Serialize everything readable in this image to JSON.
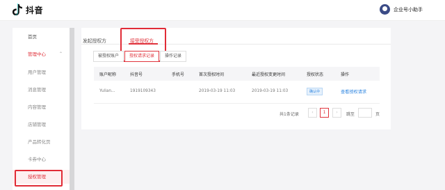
{
  "header": {
    "app_name": "抖音",
    "user_name": "企业号小助手"
  },
  "sidebar": {
    "items": [
      {
        "label": "首页"
      },
      {
        "label": "管理中心"
      },
      {
        "label": "用户管理"
      },
      {
        "label": "消息管理"
      },
      {
        "label": "内容管理"
      },
      {
        "label": "店铺管理"
      },
      {
        "label": "产品转化页"
      },
      {
        "label": "卡券中心"
      },
      {
        "label": "授权管理"
      }
    ]
  },
  "tabs": {
    "items": [
      {
        "label": "发起授权方"
      },
      {
        "label": "接受授权方"
      }
    ]
  },
  "subtabs": {
    "items": [
      {
        "label": "被授权账户"
      },
      {
        "label": "授权请求记录"
      },
      {
        "label": "操作记录"
      }
    ]
  },
  "table": {
    "columns": [
      "账户昵称",
      "抖音号",
      "手机号",
      "首次授权时间",
      "最近授权变更时间",
      "授权状态",
      "操作"
    ],
    "rows": [
      {
        "nickname": "Yulian...",
        "douyin_id": "1919109343",
        "phone": "",
        "first_time": "2019-03-19 11:03",
        "last_time": "2019-03-19 11:03",
        "status": "确认中",
        "action": "查看授权请求"
      }
    ]
  },
  "pagination": {
    "total": "共1条记录",
    "prev": "‹",
    "page": "1",
    "next": "›",
    "goto": "跳至",
    "page_unit": "页"
  }
}
